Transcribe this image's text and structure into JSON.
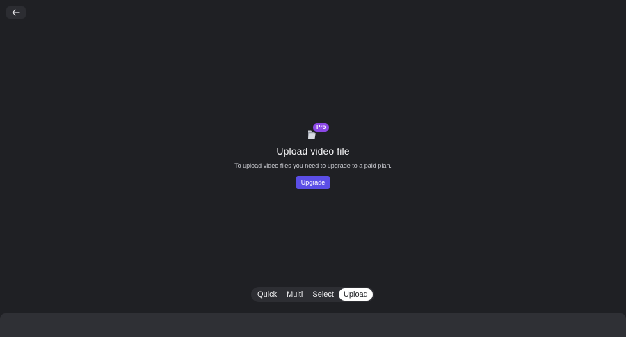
{
  "icons": {
    "back": "arrow-left-icon",
    "folder": "folder-icon"
  },
  "colors": {
    "background": "#1f2024",
    "accent": "#5b4ee6",
    "pro_badge": "#8b47e6",
    "active_tab_bg": "#ffffff"
  },
  "upload": {
    "badge": "Pro",
    "title": "Upload video file",
    "message": "To upload video files you need to upgrade to a paid plan.",
    "upgrade_label": "Upgrade"
  },
  "modes": {
    "tabs": [
      {
        "label": "Quick",
        "active": false
      },
      {
        "label": "Multi",
        "active": false
      },
      {
        "label": "Select",
        "active": false
      },
      {
        "label": "Upload",
        "active": true
      }
    ]
  }
}
